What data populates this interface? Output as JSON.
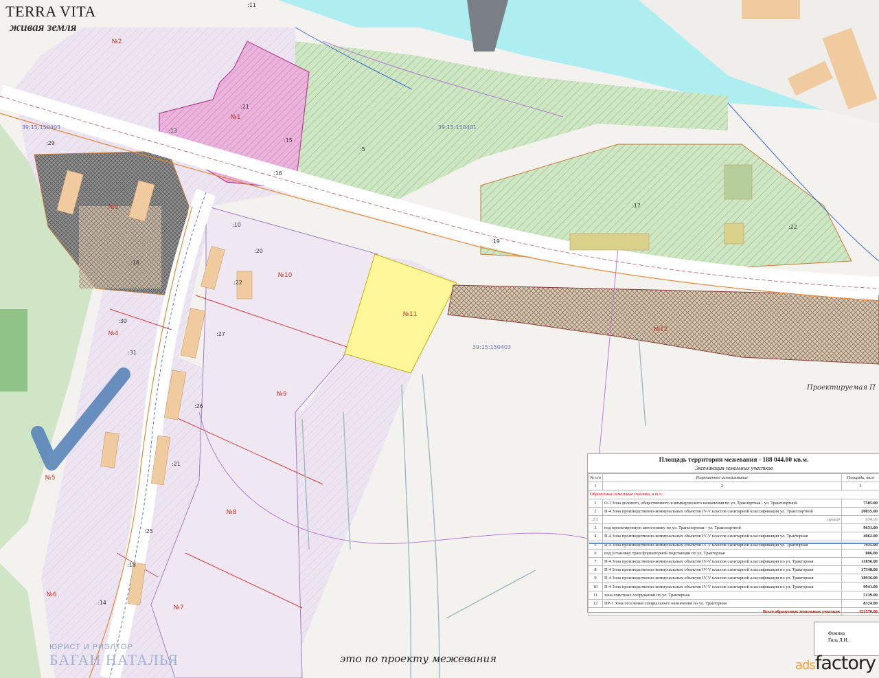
{
  "brand": {
    "title": "TERRA VITA",
    "subtitle": "живая земля"
  },
  "caption": "это по проекту межевания",
  "realtor": {
    "top": "ЮРИСТ И РИЭЛТОР",
    "name": "БАГАН НАТАЛЬЯ"
  },
  "watermark": {
    "ads": "ads",
    "factory": "factory"
  },
  "colors": {
    "water": "#aeeef0",
    "green": "#bfe0b4",
    "pink": "#e8a8d8",
    "grey_hatch": "#8c8c8c",
    "yellow": "#fff799",
    "lavender": "#ede6f2",
    "checkmark": "#5a84b8"
  },
  "parcels": [
    {
      "id": "№1",
      "label": "№1"
    },
    {
      "id": "№2",
      "label": "№2"
    },
    {
      "id": "№3",
      "label": "№3"
    },
    {
      "id": "№4",
      "label": "№4"
    },
    {
      "id": "№5",
      "label": "№5"
    },
    {
      "id": "№6",
      "label": "№6"
    },
    {
      "id": "№7",
      "label": "№7"
    },
    {
      "id": "№8",
      "label": "№8"
    },
    {
      "id": "№9",
      "label": "№9"
    },
    {
      "id": "№10",
      "label": "№10"
    },
    {
      "id": "№11",
      "label": "№11"
    },
    {
      "id": "№12",
      "label": "№12"
    }
  ],
  "cadastral": [
    "39:15:150403",
    "39:15:150401",
    "39:15:150403"
  ],
  "numbers": [
    ":11",
    ":21",
    ":13",
    ":15",
    ":16",
    ":29",
    ":5",
    ":17",
    ":19",
    ":22",
    ":10",
    ":20",
    ":18",
    ":22",
    ":30",
    ":31",
    ":27",
    ":26",
    ":21",
    ":25",
    ":18",
    ":14"
  ],
  "road_label": "Проектируемая П",
  "table": {
    "title": "Площадь территории межевания - 188 044.00 кв.м.",
    "subtitle": "Экспликация земельных участков",
    "headers": [
      "№ п/п",
      "Разрешенное использование",
      "Площадь, кв.м"
    ],
    "col_index": [
      "1",
      "2",
      "3"
    ],
    "group": "Образуемые земельные участки, в т.ч.:",
    "rows": [
      {
        "n": "1",
        "use": "О-1 Зона делового, общественного и коммерческого назначения по ул. Траклортная - ул. Транспортной",
        "area": "7585.00"
      },
      {
        "n": "2",
        "use": "П-4 Зона производственно-коммунальных объектов IV-V классов санитарной классификации ул. Транспортной",
        "area": "20035.00"
      },
      {
        "n": "2/1",
        "use": "",
        "note": "проезд",
        "area": "654.00"
      },
      {
        "n": "3",
        "use": "под проектируемую автостоянку по ул. Транспортная - ул. Транспортной",
        "area": "9631.00"
      },
      {
        "n": "4",
        "use": "П-4 Зона производственно-коммунальных объектов IV-V классов санитарной классификации ул. Тракторная",
        "area": "4062.00"
      },
      {
        "n": "5",
        "use": "П-4 Зона производственно-коммунальных объектов IV-V классов санитарной классификации ул. Тракторная",
        "area": "7935.00"
      },
      {
        "n": "6",
        "use": "под установку трансформаторной подстанции по ул. Тракторная",
        "area": "806.00"
      },
      {
        "n": "7",
        "use": "П-4 Зона производственно-коммунальных объектов IV-V классов санитарной классификации по ул. Тракторная",
        "area": "11856.00"
      },
      {
        "n": "8",
        "use": "П-4 Зона производственно-коммунальных объектов IV-V классов санитарной классификации по ул. Тракторная",
        "area": "17348.00"
      },
      {
        "n": "9",
        "use": "П-4 Зона производственно-коммунальных объектов IV-V классов санитарной классификации по ул. Тракторная",
        "area": "18936.00"
      },
      {
        "n": "10",
        "use": "П-4 Зона производственно-коммунальных объектов IV-V классов санитарной классификации по ул. Тракторная",
        "area": "9941.00"
      },
      {
        "n": "11",
        "use": "зона очистных сооружений по ул. Тракторная",
        "area": "5139.00"
      },
      {
        "n": "12",
        "use": "ПР-1 Зона отселения специального назначения по ул. Тракторная",
        "area": "8324.00"
      }
    ],
    "total": "Всего образуемых земельных участков",
    "total_area": "121570.00"
  },
  "stamp": [
    "Фомина",
    "Гиль Л.И."
  ]
}
